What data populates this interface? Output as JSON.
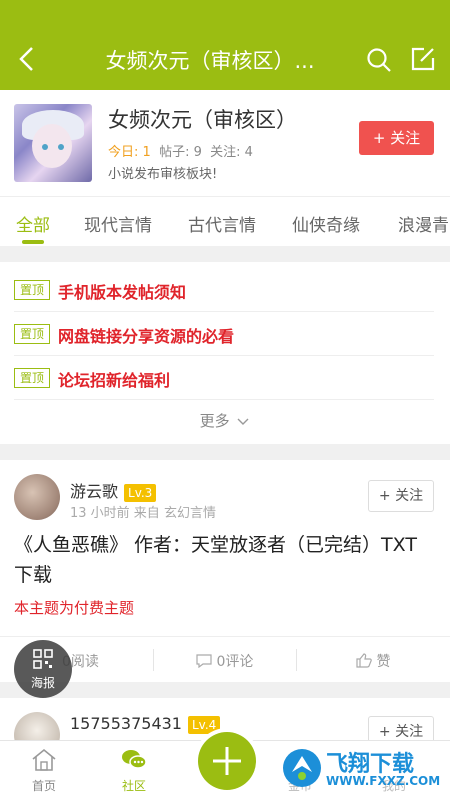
{
  "header": {
    "title": "女频次元（审核区）..."
  },
  "forum": {
    "name": "女频次元（审核区）",
    "today": "今日: 1",
    "posts": "帖子: 9",
    "follows": "关注: 4",
    "description": "小说发布审核板块!",
    "follow_label": "+ 关注"
  },
  "tabs": [
    {
      "label": "全部"
    },
    {
      "label": "现代言情"
    },
    {
      "label": "古代言情"
    },
    {
      "label": "仙侠奇缘"
    },
    {
      "label": "浪漫青"
    }
  ],
  "pinned": {
    "tag": "置顶",
    "items": [
      {
        "text": "手机版本发帖须知"
      },
      {
        "text": "网盘链接分享资源的必看"
      },
      {
        "text": "论坛招新给福利"
      }
    ],
    "more_label": "更多"
  },
  "posts": [
    {
      "user": "游云歌",
      "level": "Lv.3",
      "meta": "13 小时前  来自 玄幻言情",
      "follow_label": "+ 关注",
      "title": "《人鱼恶礁》 作者：天堂放逐者（已完结）TXT下载",
      "paid_note": "本主题为付费主题",
      "reads": "0阅读",
      "comments": "0评论",
      "like": "赞"
    },
    {
      "user": "15755375431",
      "level": "Lv.4",
      "follow_label": "+ 关注"
    }
  ],
  "fab_poster": {
    "label": "海报"
  },
  "bottom_nav": {
    "home": "首页",
    "community": "社区",
    "item4": "金币",
    "item5": "我的"
  },
  "watermark": {
    "text": "飞翔下载",
    "url": "WWW.FXXZ.COM"
  },
  "colors": {
    "accent": "#9bbd12",
    "danger": "#e0242b",
    "follow": "#f0524f",
    "level": "#f4c000"
  }
}
